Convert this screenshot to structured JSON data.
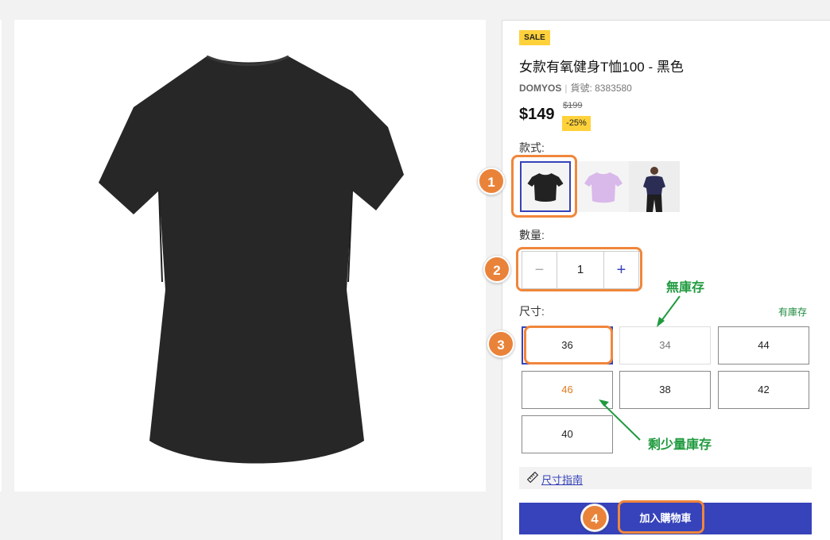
{
  "product": {
    "badge": "SALE",
    "title": "女款有氧健身T恤100 - 黑色",
    "brand": "DOMYOS",
    "separator": "|",
    "sku_label": "貨號: 8383580",
    "price": "$149",
    "old_price": "$199",
    "discount": "-25%"
  },
  "style": {
    "label": "款式:",
    "options": [
      "black-tshirt",
      "lilac-tshirt",
      "navy-tshirt-model"
    ],
    "selected_index": 0
  },
  "quantity": {
    "label": "數量:",
    "minus": "−",
    "value": "1",
    "plus": "+"
  },
  "size": {
    "label": "尺寸:",
    "in_stock_note": "有庫存",
    "options": [
      {
        "label": "36",
        "state": "selected"
      },
      {
        "label": "34",
        "state": "out-of-stock"
      },
      {
        "label": "44",
        "state": "available"
      },
      {
        "label": "46",
        "state": "low-stock"
      },
      {
        "label": "38",
        "state": "available"
      },
      {
        "label": "42",
        "state": "available"
      },
      {
        "label": "40",
        "state": "available"
      }
    ]
  },
  "size_guide": {
    "label": "尺寸指南",
    "icon": "ruler-icon"
  },
  "cart": {
    "label": "加入購物車"
  },
  "annotations": {
    "steps": [
      "1",
      "2",
      "3",
      "4"
    ],
    "out_of_stock": "無庫存",
    "low_stock": "剩少量庫存"
  },
  "colors": {
    "accent": "#3643ba",
    "sale": "#ffd13b",
    "highlight": "#f0863b",
    "annotation": "#1f9a3e",
    "low_stock": "#e07a1f"
  }
}
